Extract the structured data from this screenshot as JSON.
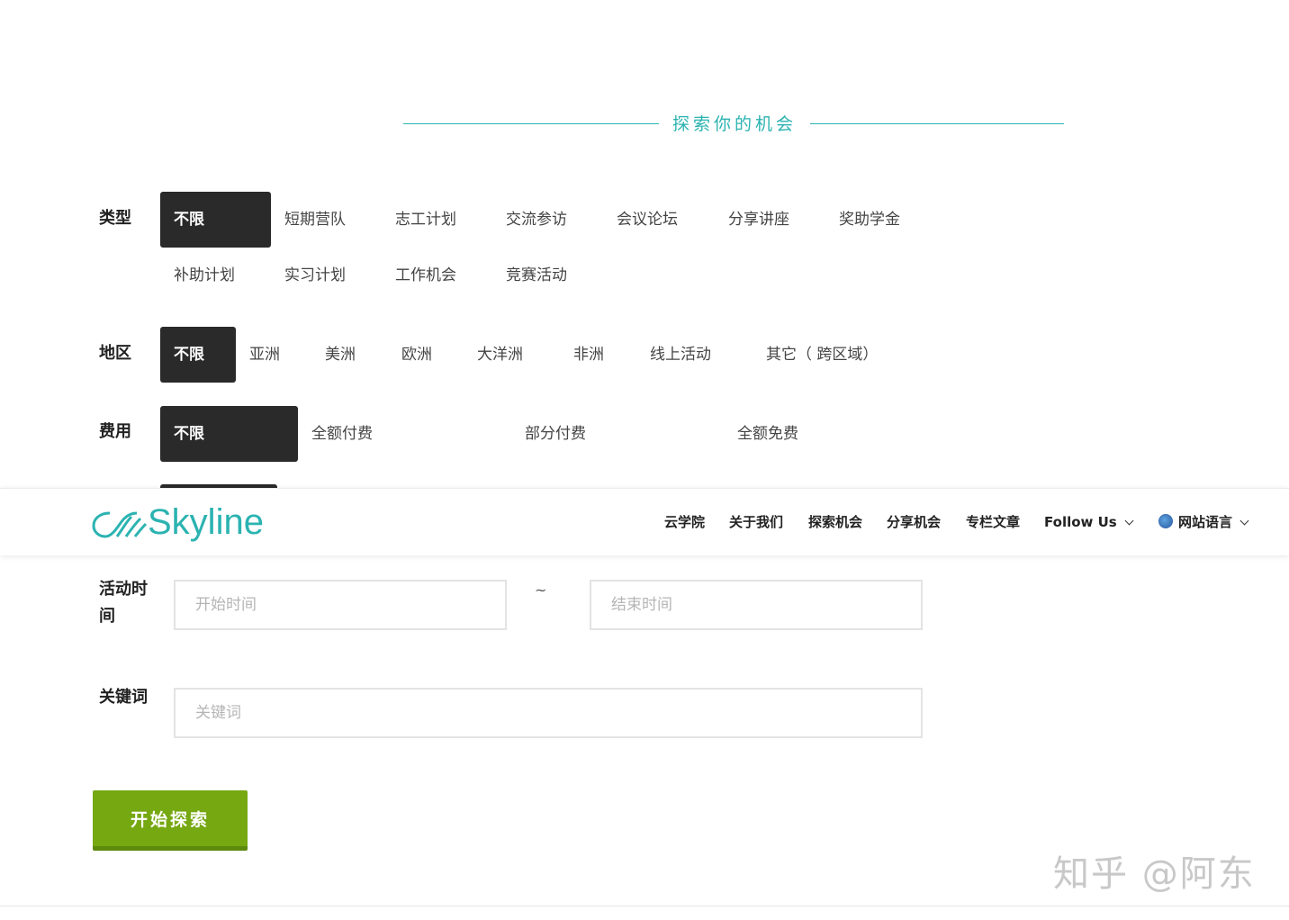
{
  "section_title": "探索你的机会",
  "filters": {
    "type": {
      "label": "类型",
      "options": [
        "不限",
        "短期营队",
        "志工计划",
        "交流参访",
        "会议论坛",
        "分享讲座",
        "奖助学金",
        "补助计划",
        "实习计划",
        "工作机会",
        "竞赛活动"
      ]
    },
    "region": {
      "label": "地区",
      "options": [
        "不限",
        "亚洲",
        "美洲",
        "欧洲",
        "大洋洲",
        "非洲",
        "线上活动",
        "其它（ 跨区域）"
      ]
    },
    "fee": {
      "label": "费用",
      "options": [
        "不限",
        "全额付费",
        "部分付费",
        "全额免费"
      ]
    }
  },
  "navbar": {
    "logo_text": "Skyline",
    "items": [
      "云学院",
      "关于我们",
      "探索机会",
      "分享机会",
      "专栏文章",
      "Follow Us",
      "网站语言"
    ]
  },
  "time": {
    "label": "活动时间",
    "start_placeholder": "开始时间",
    "separator": "~",
    "end_placeholder": "结束时间"
  },
  "keyword": {
    "label": "关键词",
    "placeholder": "关键词"
  },
  "search_button": "开始探索",
  "watermark": "知乎 @阿东",
  "colors": {
    "accent": "#2bb3b1",
    "button": "#76a812",
    "active_bg": "#2a2a2a"
  }
}
